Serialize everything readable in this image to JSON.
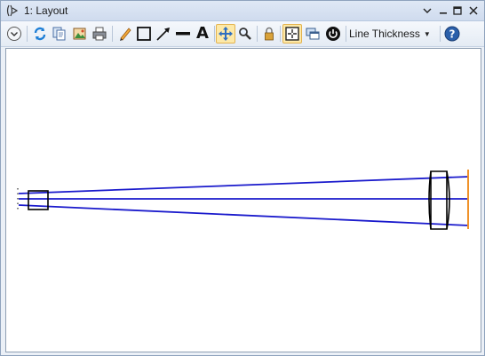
{
  "window": {
    "title": "1: Layout",
    "controls": {
      "dropdown_icon": "chevron-down-icon",
      "close_icon": "close-icon",
      "restore_icon": "restore-icon",
      "minimize_icon": "minimize-icon"
    }
  },
  "toolbar": {
    "buttons": [
      {
        "name": "settings-toggle-button",
        "icon": "chevron-circle-icon"
      },
      {
        "name": "refresh-button",
        "icon": "refresh-icon"
      },
      {
        "name": "copy-button",
        "icon": "copy-icon"
      },
      {
        "name": "save-image-button",
        "icon": "image-icon"
      },
      {
        "name": "print-button",
        "icon": "printer-icon"
      },
      {
        "name": "pencil-button",
        "icon": "pencil-icon"
      },
      {
        "name": "rectangle-button",
        "icon": "rectangle-icon"
      },
      {
        "name": "arrow-button",
        "icon": "arrow-icon"
      },
      {
        "name": "line-button",
        "icon": "line-icon"
      },
      {
        "name": "text-button",
        "icon": "text-icon",
        "glyph": "A"
      },
      {
        "name": "pan-button",
        "icon": "move-icon",
        "active": true
      },
      {
        "name": "zoom-button",
        "icon": "zoom-icon"
      },
      {
        "name": "lock-button",
        "icon": "lock-icon"
      },
      {
        "name": "fit-view-button",
        "icon": "fit-icon",
        "active": true
      },
      {
        "name": "window-view-button",
        "icon": "windows-icon"
      },
      {
        "name": "reset-button",
        "icon": "power-icon"
      },
      {
        "name": "help-button",
        "icon": "help-icon"
      }
    ],
    "line_thickness_label": "Line Thickness"
  },
  "layout": {
    "ray_color": "#1a1acc",
    "element_color": "#000000",
    "image_plane_color": "#f0922a"
  }
}
